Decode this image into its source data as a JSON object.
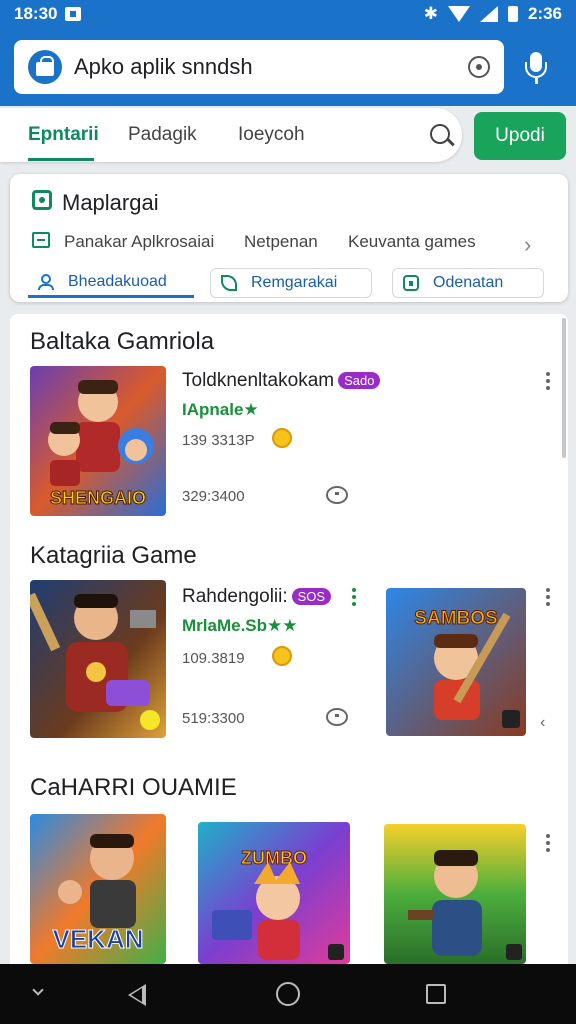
{
  "status_bar": {
    "time": "18:30",
    "battery": "2:36"
  },
  "search": {
    "text": "Apko aplik snndsh"
  },
  "tabs": [
    {
      "label": "Epntarii",
      "active": true
    },
    {
      "label": "Padagik",
      "active": false
    },
    {
      "label": "Ioeycoh",
      "active": false
    }
  ],
  "update_button": "Upodi",
  "filter_card": {
    "title": "Maplargai",
    "categories": [
      "Panakar Aplkrosaiai",
      "Netpenan",
      "Keuvanta games"
    ],
    "chips": [
      "Bheadakuoad",
      "Remgarakai",
      "Odenatan"
    ]
  },
  "sections": [
    {
      "title": "Baltaka Gamriola",
      "apps": [
        {
          "name": "Toldknenltakokam",
          "badge": "Sado",
          "rating": "IApnale★",
          "downloads": "139 3313P",
          "size": "329:3400"
        }
      ]
    },
    {
      "title": "Katagriia Game",
      "apps": [
        {
          "name": "Rahdengolii:",
          "badge": "SOS",
          "rating": "MrlaMe.Sb★★",
          "downloads": "109.3819",
          "size": "519:3300"
        }
      ]
    },
    {
      "title": "CaHARRI OUAMIE",
      "apps": []
    }
  ],
  "thumbnails": {
    "t1_caption": "SHENGAIO",
    "t3_caption_top": "SAMBOS",
    "t4_caption": "VEKAN",
    "t5_caption": "ZUMBO"
  },
  "colors": {
    "primary": "#1a73c8",
    "accent": "#0f8a5f",
    "update": "#1aa35a",
    "badge": "#9b2bc9",
    "rating": "#1a8f3c"
  }
}
